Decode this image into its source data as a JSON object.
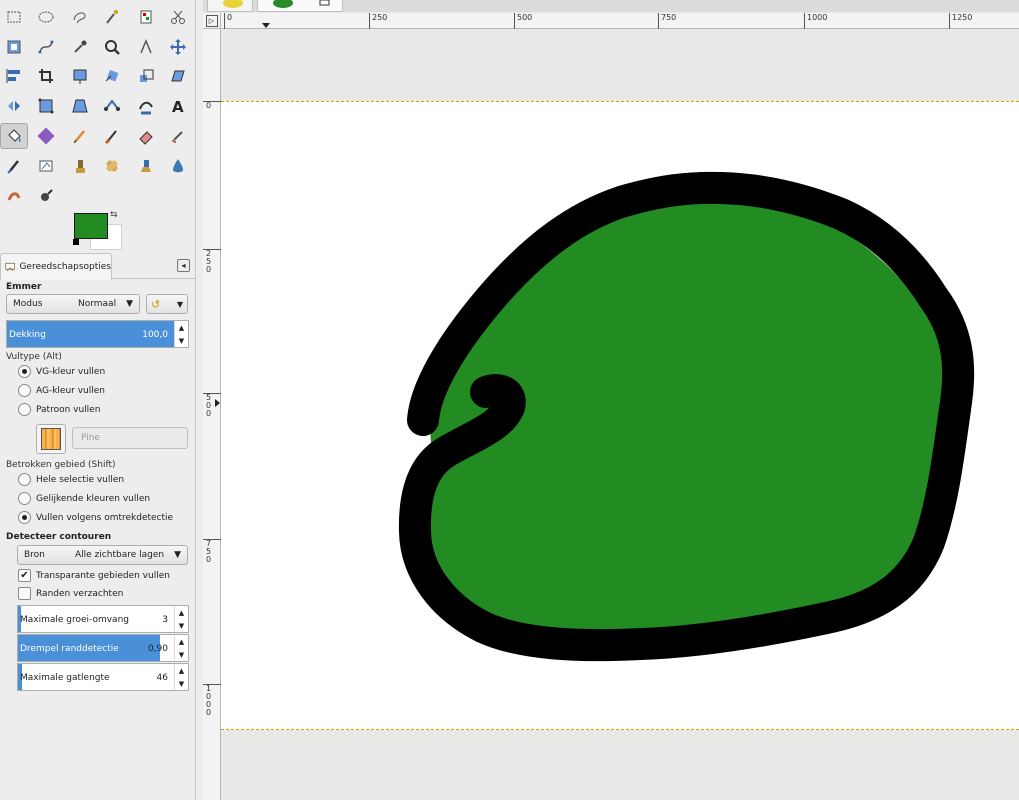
{
  "toolbox": {
    "tools": [
      {
        "name": "rect-select"
      },
      {
        "name": "ellipse-select"
      },
      {
        "name": "free-select"
      },
      {
        "name": "fuzzy-select"
      },
      {
        "name": "color-select"
      },
      {
        "name": "scissors-select"
      },
      {
        "name": "foreground-select"
      },
      {
        "name": "paths"
      },
      {
        "name": "color-picker"
      },
      {
        "name": "zoom"
      },
      {
        "name": "measure"
      },
      {
        "name": "move"
      },
      {
        "name": "align"
      },
      {
        "name": "crop"
      },
      {
        "name": "unified-transform"
      },
      {
        "name": "rotate"
      },
      {
        "name": "scale"
      },
      {
        "name": "shear"
      },
      {
        "name": "flip"
      },
      {
        "name": "cage-transform"
      },
      {
        "name": "perspective"
      },
      {
        "name": "handle-transform"
      },
      {
        "name": "warp-transform"
      },
      {
        "name": "text"
      },
      {
        "name": "bucket-fill",
        "active": true
      },
      {
        "name": "gradient"
      },
      {
        "name": "pencil"
      },
      {
        "name": "paintbrush"
      },
      {
        "name": "eraser"
      },
      {
        "name": "airbrush"
      },
      {
        "name": "ink"
      },
      {
        "name": "mypaint-brush"
      },
      {
        "name": "clone"
      },
      {
        "name": "heal"
      },
      {
        "name": "perspective-clone"
      },
      {
        "name": "blur-sharpen"
      },
      {
        "name": "smudge"
      },
      {
        "name": "dodge-burn"
      }
    ],
    "foreground_color": "#228b22",
    "background_color": "#ffffff"
  },
  "tab": {
    "label": "Gereedschapsopties"
  },
  "options": {
    "tool_title": "Emmer",
    "mode_label": "Modus",
    "mode_value": "Normaal",
    "opacity_label": "Dekking",
    "opacity_value": "100,0",
    "opacity_fraction": 1.0,
    "filltype_heading": "Vultype  (Alt)",
    "fill_fg": "VG-kleur vullen",
    "fill_bg": "AG-kleur vullen",
    "fill_pattern": "Patroon vullen",
    "pattern_name": "Pine",
    "area_heading": "Betrokken gebied  (Shift)",
    "area_selection": "Hele selectie vullen",
    "area_similar": "Gelijkende kleuren vullen",
    "area_lineart": "Vullen volgens omtrekdetectie",
    "detect_heading": "Detecteer contouren",
    "source_label": "Bron",
    "source_value": "Alle zichtbare lagen",
    "transparent_label": "Transparante gebieden vullen",
    "transparent_checked": true,
    "antialias_label": "Randen verzachten",
    "antialias_checked": false,
    "max_grow_label": "Maximale groei-omvang",
    "max_grow_value": "3",
    "max_grow_fraction": 0.03,
    "threshold_label": "Drempel randdetectie",
    "threshold_value": "0,90",
    "threshold_fraction": 0.9,
    "max_gap_label": "Maximale gatlengte",
    "max_gap_value": "46",
    "max_gap_fraction": 0.04
  },
  "rulers": {
    "h_ticks": [
      "0",
      "250",
      "500",
      "750",
      "1000",
      "1250"
    ],
    "v_ticks": [
      "0",
      "250",
      "500",
      "750",
      "1000"
    ]
  },
  "canvas": {
    "fill_color": "#228b22",
    "outline_color": "#000000"
  }
}
